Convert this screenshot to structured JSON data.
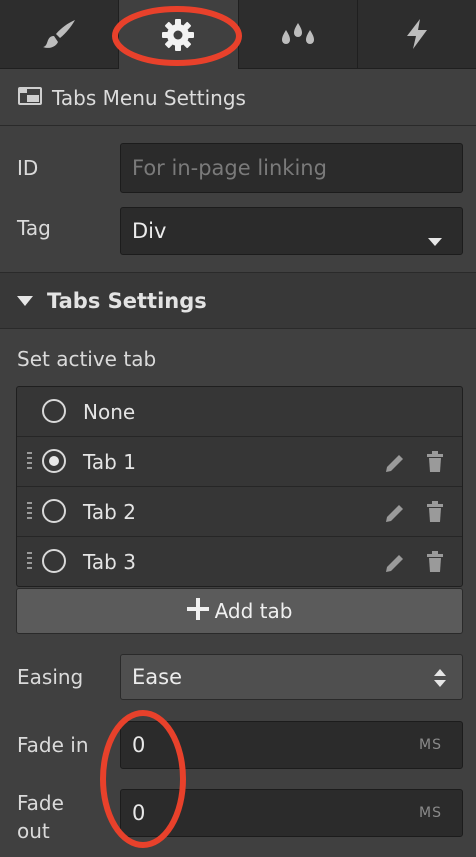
{
  "tabs": [
    {
      "name": "style",
      "icon": "paintbrush-icon"
    },
    {
      "name": "settings",
      "icon": "gear-icon",
      "active": true
    },
    {
      "name": "interactions",
      "icon": "drops-icon"
    },
    {
      "name": "lightning",
      "icon": "lightning-icon"
    }
  ],
  "element_header": {
    "icon": "tabs-menu-icon",
    "title": "Tabs Menu Settings"
  },
  "id_field": {
    "label": "ID",
    "value": "",
    "placeholder": "For in-page linking"
  },
  "tag_field": {
    "label": "Tag",
    "value": "Div"
  },
  "tabs_settings": {
    "title": "Tabs Settings",
    "set_active_label": "Set active tab",
    "items": [
      {
        "label": "None",
        "checked": false
      },
      {
        "label": "Tab 1",
        "checked": true
      },
      {
        "label": "Tab 2",
        "checked": false
      },
      {
        "label": "Tab 3",
        "checked": false
      }
    ],
    "add_tab_label": "Add tab"
  },
  "easing": {
    "label": "Easing",
    "value": "Ease"
  },
  "fade_in": {
    "label": "Fade in",
    "value": "0",
    "unit": "MS"
  },
  "fade_out": {
    "label_line1": "Fade",
    "label_line2": "out",
    "value": "0",
    "unit": "MS"
  },
  "colors": {
    "panel_bg": "#404040",
    "annotation": "#e8412b"
  }
}
